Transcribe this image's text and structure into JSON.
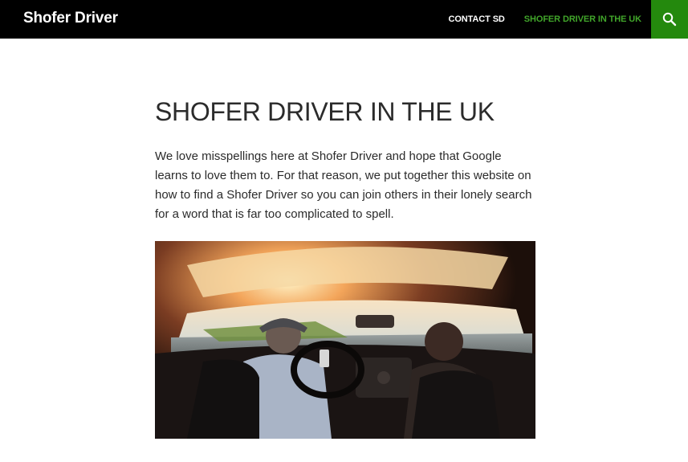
{
  "header": {
    "site_title": "Shofer Driver",
    "nav": [
      {
        "label": "CONTACT SD"
      },
      {
        "label": "SHOFER DRIVER IN THE UK"
      }
    ],
    "search_icon": "search-icon"
  },
  "main": {
    "title": "SHOFER DRIVER IN THE UK",
    "intro": "We love misspellings here at Shofer Driver and hope that Google learns to love them to. For that reason, we put together this website on how to find a Shofer Driver so you can join others in their lonely search for a word that is far too complicated to spell."
  },
  "colors": {
    "header_bg": "#000000",
    "accent": "#41a62a",
    "search_bg": "#24890d",
    "text": "#2b2b2b"
  }
}
